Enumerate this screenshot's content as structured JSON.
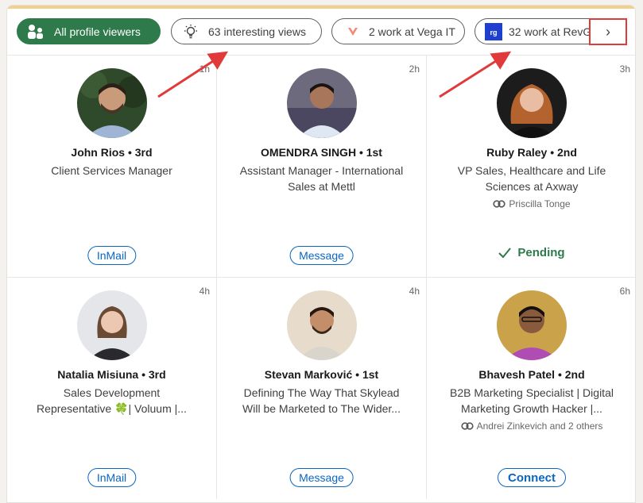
{
  "filters": [
    {
      "label": "All profile viewers",
      "icon": "people-icon",
      "active": true
    },
    {
      "label": "63 interesting views",
      "icon": "lightbulb-icon",
      "active": false
    },
    {
      "label": "2 work at Vega IT",
      "icon": "vega-logo-icon",
      "active": false
    },
    {
      "label": "32 work at RevG",
      "icon": "revg-logo-icon",
      "active": false
    }
  ],
  "next_button": {
    "label": "›",
    "icon": "chevron-right-icon"
  },
  "viewers": [
    {
      "name": "John Rios • 3rd",
      "headline1": "Client Services Manager",
      "headline2": "",
      "time": "1h",
      "mutual": "",
      "action": "InMail",
      "action_type": "pill"
    },
    {
      "name": "OMENDRA SINGH • 1st",
      "headline1": "Assistant Manager - International",
      "headline2": "Sales at Mettl",
      "time": "2h",
      "mutual": "",
      "action": "Message",
      "action_type": "pill"
    },
    {
      "name": "Ruby Raley • 2nd",
      "headline1": "VP Sales, Healthcare and Life",
      "headline2": "Sciences at Axway",
      "time": "3h",
      "mutual": "Priscilla Tonge",
      "action": "Pending",
      "action_type": "pending"
    },
    {
      "name": "Natalia Misiuna • 3rd",
      "headline1": "Sales Development",
      "headline2": "Representative 🍀| Voluum |...",
      "time": "4h",
      "mutual": "",
      "action": "InMail",
      "action_type": "pill"
    },
    {
      "name": "Stevan Marković • 1st",
      "headline1": "Defining The Way That Skylead",
      "headline2": "Will be Marketed to The Wider...",
      "time": "4h",
      "mutual": "",
      "action": "Message",
      "action_type": "pill"
    },
    {
      "name": "Bhavesh Patel • 2nd",
      "headline1": "B2B Marketing Specialist | Digital",
      "headline2": "Marketing Growth Hacker |...",
      "time": "6h",
      "mutual": "Andrei Zinkevich and 2 others",
      "action": "Connect",
      "action_type": "bold"
    }
  ],
  "colors": {
    "accent_green": "#2f7a4b",
    "link_blue": "#0a66c2",
    "annotation_red": "#e03a3a"
  }
}
